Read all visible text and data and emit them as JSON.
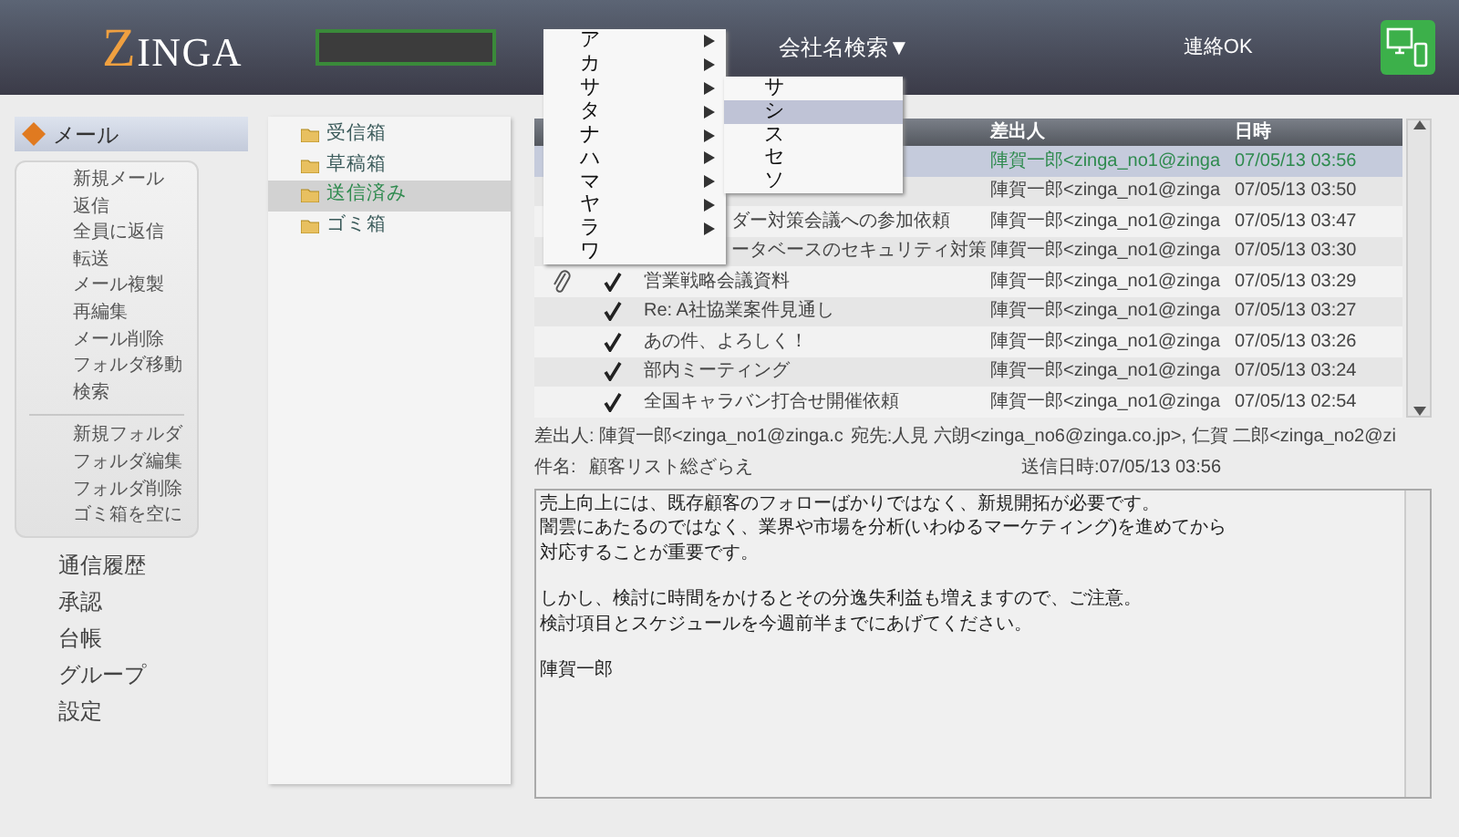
{
  "header": {
    "logo": "ZINGA",
    "company_search": "会社名検索▼",
    "status": "連絡OK"
  },
  "kana_menu": [
    {
      "label": "ア",
      "has_submenu": true
    },
    {
      "label": "カ",
      "has_submenu": true
    },
    {
      "label": "サ",
      "has_submenu": true,
      "children": [
        {
          "label": "サ",
          "selected": false
        },
        {
          "label": "シ",
          "selected": true
        },
        {
          "label": "ス",
          "selected": false
        },
        {
          "label": "セ",
          "selected": false
        },
        {
          "label": "ソ",
          "selected": false
        }
      ]
    },
    {
      "label": "タ",
      "has_submenu": true
    },
    {
      "label": "ナ",
      "has_submenu": true
    },
    {
      "label": "ハ",
      "has_submenu": true
    },
    {
      "label": "マ",
      "has_submenu": true
    },
    {
      "label": "ヤ",
      "has_submenu": true
    },
    {
      "label": "ラ",
      "has_submenu": true
    },
    {
      "label": "ワ",
      "has_submenu": false
    }
  ],
  "sidebar": {
    "section": {
      "label": "メール",
      "selected": true
    },
    "mail_actions": [
      "新規メール",
      "返信",
      "全員に返信",
      "転送",
      "メール複製",
      "再編集",
      "メール削除",
      "フォルダ移動",
      "検索"
    ],
    "folder_actions": [
      "新規フォルダ",
      "フォルダ編集",
      "フォルダ削除",
      "ゴミ箱を空に"
    ],
    "nav": [
      "通信履歴",
      "承認",
      "台帳",
      "グループ",
      "設定"
    ]
  },
  "folders": [
    {
      "label": "受信箱",
      "selected": false
    },
    {
      "label": "草稿箱",
      "selected": false
    },
    {
      "label": "送信済み",
      "selected": true
    },
    {
      "label": "ゴミ箱",
      "selected": false
    }
  ],
  "mail_list": {
    "columns": [
      "差出人",
      "日時"
    ],
    "rows": [
      {
        "sender": "陣賀一郎<zinga_no1@zinga",
        "date": "07/05/13 03:56",
        "selected": true
      },
      {
        "sender": "陣賀一郎<zinga_no1@zinga",
        "date": "07/05/13 03:50",
        "selected": false
      },
      {
        "subject": "ダー対策会議への参加依頼",
        "sender": "陣賀一郎<zinga_no1@zinga",
        "date": "07/05/13 03:47",
        "selected": false
      },
      {
        "subject": "ータベースのセキュリティ対策",
        "sender": "陣賀一郎<zinga_no1@zinga",
        "date": "07/05/13 03:30",
        "selected": false
      },
      {
        "attachment": true,
        "read": true,
        "subject": "営業戦略会議資料",
        "sender": "陣賀一郎<zinga_no1@zinga",
        "date": "07/05/13 03:29",
        "selected": false
      },
      {
        "attachment": false,
        "read": true,
        "subject": "Re:  A社協業案件見通し",
        "sender": "陣賀一郎<zinga_no1@zinga",
        "date": "07/05/13 03:27",
        "selected": false
      },
      {
        "attachment": false,
        "read": true,
        "subject": "あの件、よろしく！",
        "sender": "陣賀一郎<zinga_no1@zinga",
        "date": "07/05/13 03:26",
        "selected": false
      },
      {
        "attachment": false,
        "read": true,
        "subject": "部内ミーティング",
        "sender": "陣賀一郎<zinga_no1@zinga",
        "date": "07/05/13 03:24",
        "selected": false
      },
      {
        "attachment": false,
        "read": true,
        "subject": "全国キャラバン打合せ開催依頼",
        "sender": "陣賀一郎<zinga_no1@zinga",
        "date": "07/05/13 02:54",
        "selected": false
      }
    ]
  },
  "detail": {
    "from": "差出人: 陣賀一郎<zinga_no1@zinga.c",
    "to": "宛先:人見 六朗<zinga_no6@zinga.co.jp>, 仁賀 二郎<zinga_no2@zi",
    "subject_label": "件名:",
    "subject": "顧客リスト総ざらえ",
    "sent": "送信日時:07/05/13 03:56"
  },
  "body": [
    [
      "売上向上には、既存顧客のフォローばかりではなく、新規開拓が必要です。",
      "闇雲にあたるのではなく、業界や市場を分析(いわゆるマーケティング)を進めてから",
      "対応することが重要です。"
    ],
    [
      "しかし、検討に時間をかけるとその分逸失利益も増えますので、ご注意。",
      "検討項目とスケジュールを今週前半までにあげてください。"
    ],
    [
      "陣賀一郎"
    ]
  ]
}
